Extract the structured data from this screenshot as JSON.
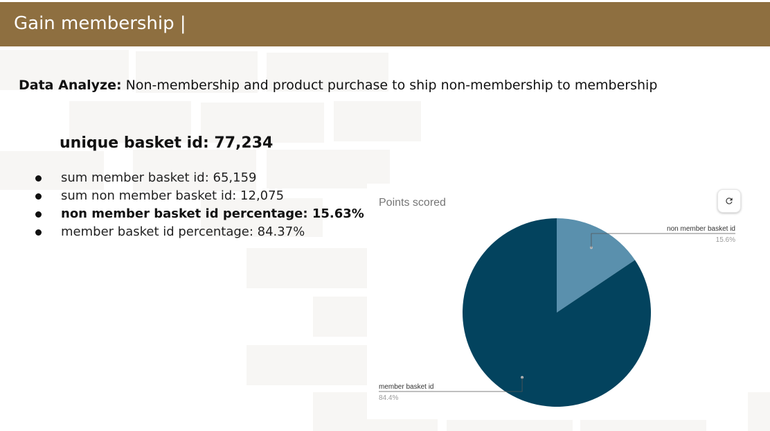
{
  "header": {
    "title": "Gain membership |"
  },
  "intro": {
    "label": "Data Analyze:",
    "text": " Non-membership and product purchase to ship non-membership to membership"
  },
  "summary": {
    "title": "unique basket id: 77,234",
    "items": [
      {
        "text": "sum member basket id: 65,159"
      },
      {
        "text": "sum non member basket id: 12,075"
      },
      {
        "text": "non member basket id percentage: 15.63%"
      },
      {
        "text": "member basket id percentage: 84.37%"
      }
    ]
  },
  "chart_data": {
    "type": "pie",
    "title": "Points scored",
    "slices": [
      {
        "label": "non member basket id",
        "value": 15.6,
        "pct_label": "15.6%",
        "color": "#5a90ad"
      },
      {
        "label": "member basket id",
        "value": 84.4,
        "pct_label": "84.4%",
        "color": "#03435e"
      }
    ],
    "legend": "none",
    "controls": {
      "refresh_icon": "refresh-icon"
    }
  },
  "colors": {
    "header": "#8e6f40"
  }
}
